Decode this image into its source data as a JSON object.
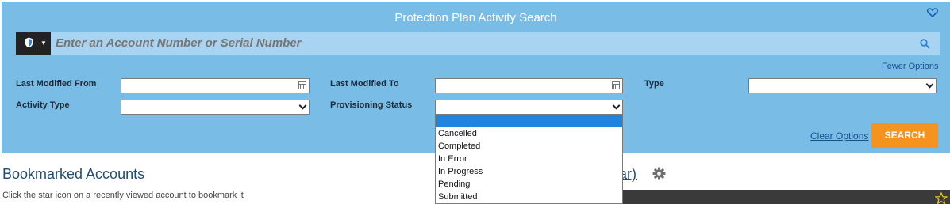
{
  "header": {
    "title": "Protection Plan Activity Search"
  },
  "search": {
    "placeholder": "Enter an Account Number or Serial Number"
  },
  "options": {
    "fewer_label": "Fewer Options",
    "last_modified_from_label": "Last Modified From",
    "last_modified_to_label": "Last Modified To",
    "type_label": "Type",
    "activity_type_label": "Activity Type",
    "provisioning_status_label": "Provisioning Status",
    "last_modified_from_value": "",
    "last_modified_to_value": "",
    "type_value": "",
    "activity_type_value": "",
    "provisioning_status_value": ""
  },
  "actions": {
    "clear_label": "Clear Options",
    "search_label": "SEARCH"
  },
  "provisioning_dropdown": {
    "items": [
      "",
      "Cancelled",
      "Completed",
      "In Error",
      "In Progress",
      "Pending",
      "Submitted"
    ]
  },
  "bookmarks": {
    "title": "Bookmarked Accounts",
    "hint": "Click the star icon on a recently viewed account to bookmark it"
  },
  "recent": {
    "partial_title": "ar)"
  },
  "colors": {
    "panel": "#79bce6",
    "search_bar": "#a9d4f1",
    "accent": "#f4931e",
    "link": "#1a4f8f",
    "selection": "#1e84e0"
  },
  "icons": {
    "collapse": "heart-outline-icon",
    "type": "shield-icon",
    "search": "magnifier-icon",
    "settings": "gear-icon",
    "bookmark": "star-outline-icon"
  }
}
